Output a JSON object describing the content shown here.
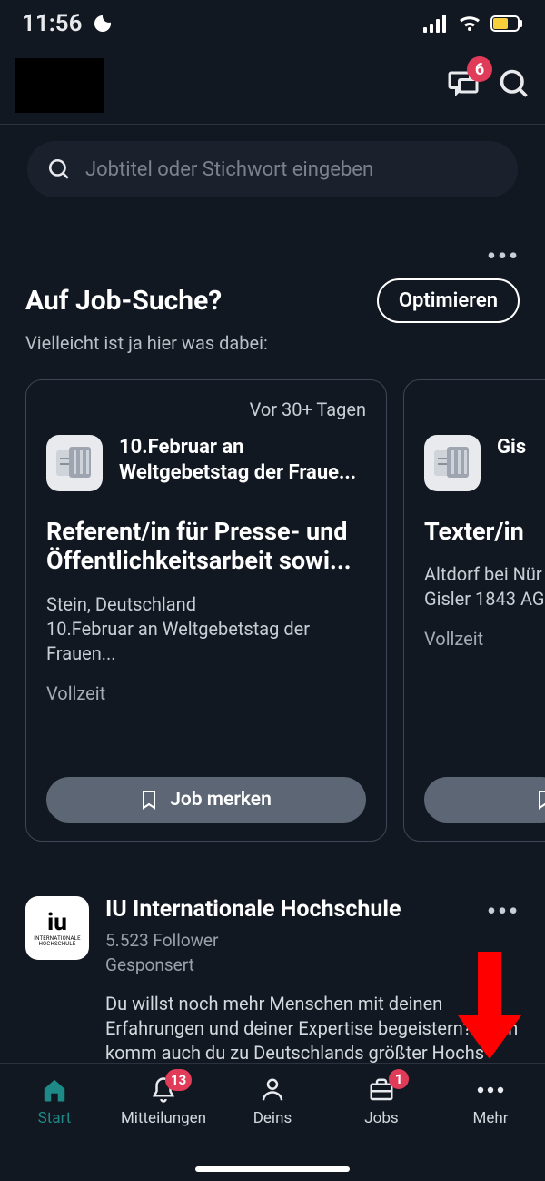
{
  "status": {
    "time": "11:56"
  },
  "header": {
    "chat_badge": "6"
  },
  "search": {
    "placeholder": "Jobtitel oder Stichwort eingeben"
  },
  "section": {
    "title": "Auf Job-Suche?",
    "subtitle": "Vielleicht ist ja hier was dabei:",
    "optimize": "Optimieren"
  },
  "cards": [
    {
      "age": "Vor 30+ Tagen",
      "company": "10.Februar an Weltgebetstag der Fraue...",
      "title": "Referent/in für Presse- und Öffentlichkeitsarbeit sowi...",
      "location": "Stein, Deutschland",
      "subline": "10.Februar an Weltgebetstag der Frauen...",
      "type": "Vollzeit",
      "bookmark": "Job merken"
    },
    {
      "company": "Gis",
      "title": "Texter/in",
      "location": "Altdorf bei Nür",
      "subline": " Gisler 1843 AG",
      "type": "Vollzeit"
    }
  ],
  "sponsored": {
    "title": "IU Internationale Hochschule",
    "followers": "5.523 Follower",
    "label": "Gesponsert",
    "text": "Du willst noch mehr Menschen mit deinen Erfahrungen und deiner Expertise begeistern? Dann komm auch du zu Deutschlands größter Hochs",
    "logo_main": "iu",
    "logo_sub": "INTERNATIONALE HOCHSCHULE"
  },
  "nav": {
    "start": "Start",
    "mitteilungen": "Mitteilungen",
    "mitteilungen_badge": "13",
    "deins": "Deins",
    "jobs": "Jobs",
    "jobs_badge": "1",
    "mehr": "Mehr"
  }
}
